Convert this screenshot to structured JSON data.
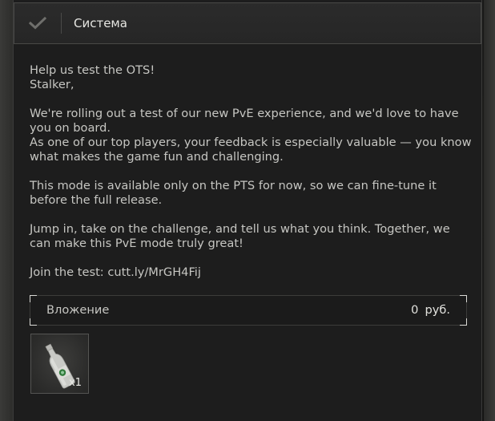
{
  "header": {
    "title": "Система",
    "confirm_icon": "checkmark-icon"
  },
  "message": {
    "lines": [
      "Help us test the OTS!",
      "Stalker,",
      "",
      "We're rolling out a test of our new PvE experience, and we'd love to have",
      "you on board.",
      "As one of our top players, your feedback is especially valuable — you know",
      "what makes the game fun and challenging.",
      "",
      "This mode is available only on the PTS for now, so we can fine-tune it",
      "before the full release.",
      "",
      "Jump in, take on the challenge, and tell us what you think. Together, we",
      "can make this PvE mode truly great!",
      "",
      "Join the test: cutt.ly/MrGH4Fij"
    ]
  },
  "attachment": {
    "label": "Вложение",
    "amount": "0",
    "currency": "руб."
  },
  "items": [
    {
      "icon": "bottle-icon",
      "count": "x1"
    }
  ],
  "colors": {
    "background": "#1d1d1d",
    "text": "#c6c6c2",
    "title": "#e6e6e2",
    "bracket": "#d9d9d5",
    "bottle_label": "#2f7a3a"
  }
}
